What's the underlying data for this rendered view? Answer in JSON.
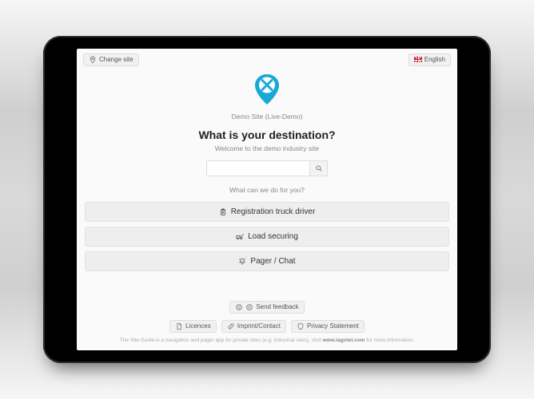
{
  "topbar": {
    "change_site_label": "Change site",
    "language_label": "English"
  },
  "site": {
    "name": "Demo Site (Live-Demo)"
  },
  "headline": {
    "question": "What is your destination?",
    "welcome": "Welcome to the demo industry site",
    "help": "What can we do for you?"
  },
  "search": {
    "value": "",
    "placeholder": ""
  },
  "actions": [
    {
      "label": "Registration truck driver",
      "icon": "clipboard-icon"
    },
    {
      "label": "Load securing",
      "icon": "truck-check-icon"
    },
    {
      "label": "Pager / Chat",
      "icon": "bell-icon"
    }
  ],
  "footer": {
    "feedback_label": "Send feedback",
    "links": [
      {
        "label": "Licences",
        "icon": "document-icon"
      },
      {
        "label": "Imprint/Contact",
        "icon": "link-icon"
      },
      {
        "label": "Privacy Statement",
        "icon": "shield-icon"
      }
    ],
    "credit_pre": "The Site Guide is a navigation and pager app for private sites (e.g. industrial sites). Visit ",
    "credit_link": "www.lagotel.com",
    "credit_post": " for more information."
  },
  "colors": {
    "accent": "#17a9d6"
  }
}
